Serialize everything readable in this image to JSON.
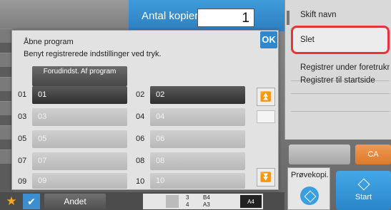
{
  "header": {
    "copies_label": "Antal kopier",
    "copies_value": "1"
  },
  "right_menu": {
    "items": [
      {
        "label": "Skift navn"
      },
      {
        "label": "Slet"
      },
      {
        "label": "Registrer under foretrukne"
      },
      {
        "label": "Registrer til startside"
      }
    ]
  },
  "dialog": {
    "title": "Åbne program",
    "description": "Benyt registrerede indstillinger ved tryk.",
    "ok_label": "OK",
    "preset_button": "Forudindst. Af program",
    "programs": [
      {
        "num": "01",
        "name": "01"
      },
      {
        "num": "02",
        "name": "02"
      },
      {
        "num": "03",
        "name": "03"
      },
      {
        "num": "04",
        "name": "04"
      },
      {
        "num": "05",
        "name": "05"
      },
      {
        "num": "06",
        "name": "06"
      },
      {
        "num": "07",
        "name": "07"
      },
      {
        "num": "08",
        "name": "08"
      },
      {
        "num": "09",
        "name": "09"
      },
      {
        "num": "10",
        "name": "10"
      }
    ]
  },
  "controls": {
    "ca_label": "CA",
    "preview_label": "Prøvekopi.",
    "start_label": "Start"
  },
  "bottom": {
    "other_label": "Andet",
    "tray_row1_num": "3",
    "tray_row1_size": "B4",
    "tray_row2_num": "4",
    "tray_row2_size": "A3",
    "paper_size": "A4"
  },
  "icons": {
    "scroll_up": "double-up-arrow",
    "scroll_down": "double-down-arrow",
    "star": "star-icon",
    "check": "check-icon"
  }
}
